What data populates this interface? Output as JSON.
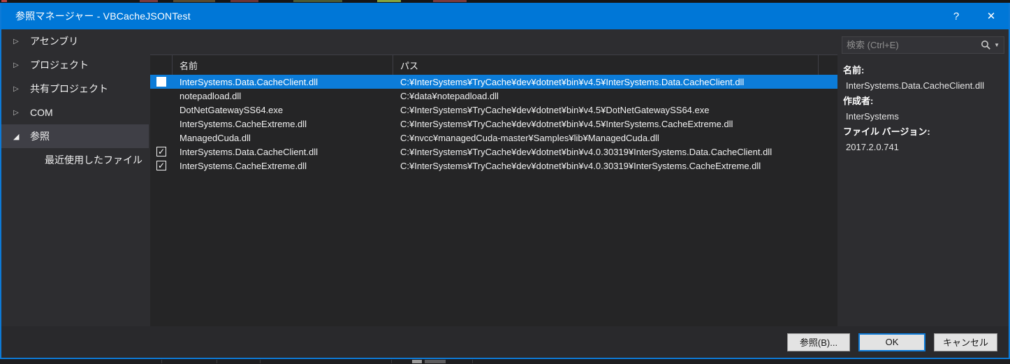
{
  "window": {
    "title": "参照マネージャー - VBCacheJSONTest",
    "help_label": "?",
    "close_label": "✕"
  },
  "colors": {
    "titlebar_blue": "#0077d7",
    "dialog_border_blue": "#0d7ad7",
    "selection_blue": "#0c7cd8",
    "dialog_bg": "#2d2d30",
    "list_bg": "#252526",
    "sidebar_selected_bg": "#3f3f46",
    "button_bg": "#e3e3e3"
  },
  "sidebar": {
    "items": [
      {
        "id": "assemblies",
        "label": "アセンブリ",
        "state": "collapsed",
        "selected": false
      },
      {
        "id": "projects",
        "label": "プロジェクト",
        "state": "collapsed",
        "selected": false
      },
      {
        "id": "shared-projects",
        "label": "共有プロジェクト",
        "state": "collapsed",
        "selected": false
      },
      {
        "id": "com",
        "label": "COM",
        "state": "collapsed",
        "selected": false
      },
      {
        "id": "browse",
        "label": "参照",
        "state": "expanded",
        "selected": true
      },
      {
        "id": "recent-files",
        "label": "最近使用したファイル",
        "state": "child",
        "selected": false
      }
    ]
  },
  "table": {
    "headers": {
      "name": "名前",
      "path": "パス"
    },
    "rows": [
      {
        "check": "unchecked",
        "selected": true,
        "name": "InterSystems.Data.CacheClient.dll",
        "path": "C:¥InterSystems¥TryCache¥dev¥dotnet¥bin¥v4.5¥InterSystems.Data.CacheClient.dll"
      },
      {
        "check": "none",
        "selected": false,
        "name": "notepadload.dll",
        "path": "C:¥data¥notepadload.dll"
      },
      {
        "check": "none",
        "selected": false,
        "name": "DotNetGatewaySS64.exe",
        "path": "C:¥InterSystems¥TryCache¥dev¥dotnet¥bin¥v4.5¥DotNetGatewaySS64.exe"
      },
      {
        "check": "none",
        "selected": false,
        "name": "InterSystems.CacheExtreme.dll",
        "path": "C:¥InterSystems¥TryCache¥dev¥dotnet¥bin¥v4.5¥InterSystems.CacheExtreme.dll"
      },
      {
        "check": "none",
        "selected": false,
        "name": "ManagedCuda.dll",
        "path": "C:¥nvcc¥managedCuda-master¥Samples¥lib¥ManagedCuda.dll"
      },
      {
        "check": "checked",
        "selected": false,
        "name": "InterSystems.Data.CacheClient.dll",
        "path": "C:¥InterSystems¥TryCache¥dev¥dotnet¥bin¥v4.0.30319¥InterSystems.Data.CacheClient.dll"
      },
      {
        "check": "checked",
        "selected": false,
        "name": "InterSystems.CacheExtreme.dll",
        "path": "C:¥InterSystems¥TryCache¥dev¥dotnet¥bin¥v4.0.30319¥InterSystems.CacheExtreme.dll"
      }
    ]
  },
  "search": {
    "placeholder": "検索 (Ctrl+E)",
    "value": ""
  },
  "details": {
    "name_label": "名前:",
    "name_value": "InterSystems.Data.CacheClient.dll",
    "author_label": "作成者:",
    "author_value": "InterSystems",
    "version_label": "ファイル バージョン:",
    "version_value": "2017.2.0.741"
  },
  "footer": {
    "browse_label": "参照(B)...",
    "ok_label": "OK",
    "cancel_label": "キャンセル"
  }
}
